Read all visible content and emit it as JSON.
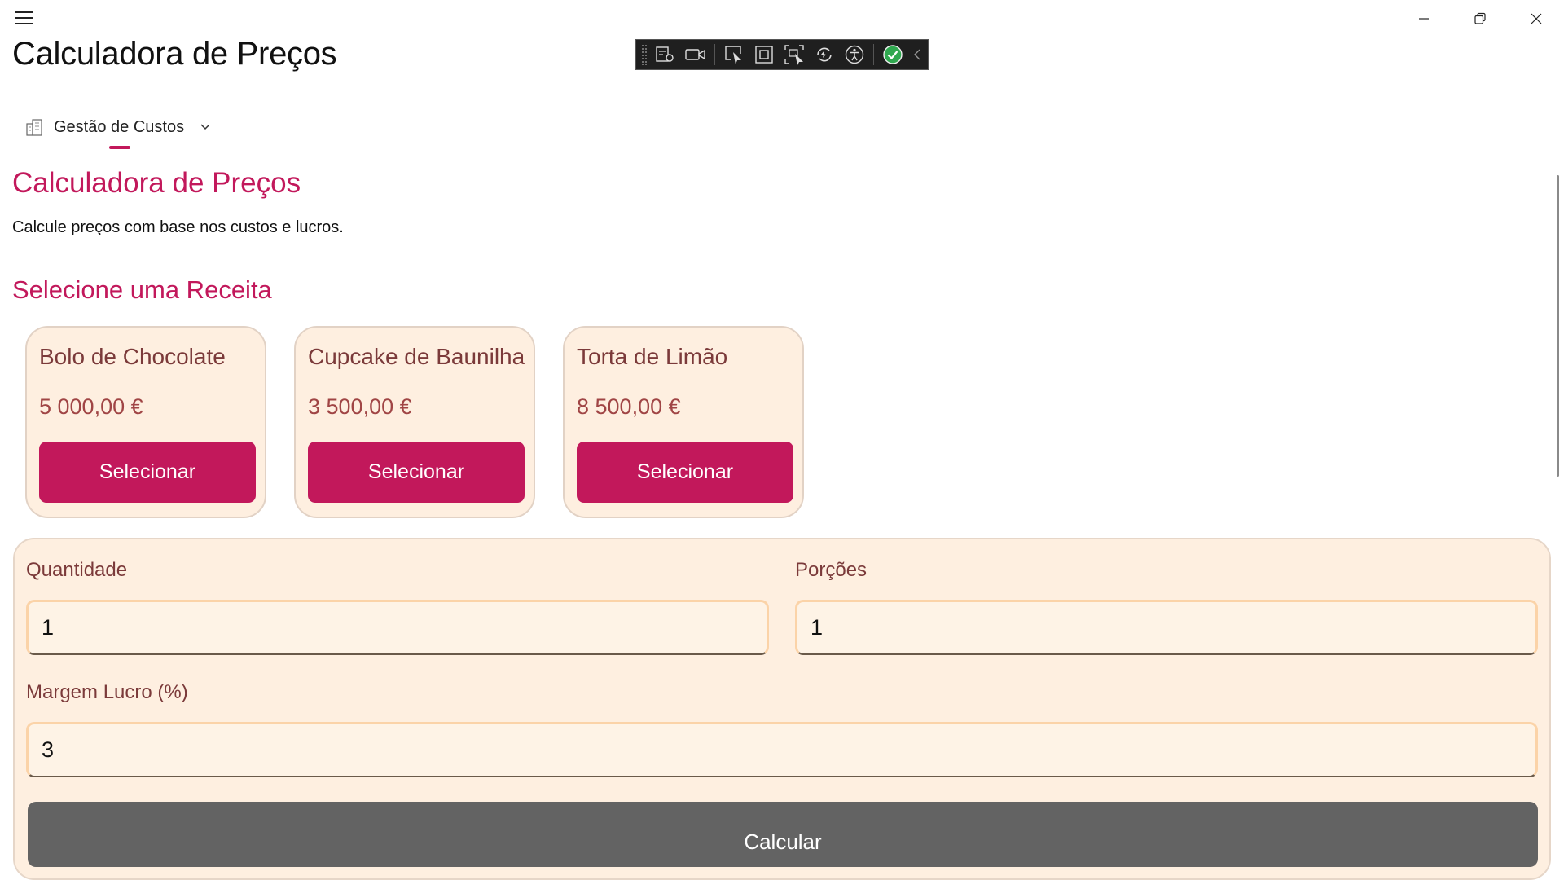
{
  "window": {
    "title": "Calculadora de Preços"
  },
  "nav": {
    "item_label": "Gestão de Custos"
  },
  "page": {
    "heading": "Calculadora de Preços",
    "subtitle": "Calcule preços com base nos custos e lucros.",
    "section_heading": "Selecione uma Receita"
  },
  "recipes": [
    {
      "name": "Bolo de Chocolate",
      "price": "5 000,00 €",
      "button": "Selecionar"
    },
    {
      "name": "Cupcake de Baunilha",
      "price": "3 500,00 €",
      "button": "Selecionar"
    },
    {
      "name": "Torta de Limão",
      "price": "8 500,00 €",
      "button": "Selecionar"
    }
  ],
  "form": {
    "quantity_label": "Quantidade",
    "quantity_value": "1",
    "portions_label": "Porções",
    "portions_value": "1",
    "margin_label": "Margem Lucro (%)",
    "margin_value": "3",
    "calculate_button": "Calcular"
  },
  "colors": {
    "accent": "#c2185b",
    "card_bg": "#feefe0",
    "label_text": "#7b3a3a",
    "price_text": "#a04545",
    "calc_button": "#636363"
  },
  "icons": {
    "menu": "hamburger-icon",
    "nav": "building-icon",
    "nav_expand": "chevron-down-icon",
    "minimize": "minimize-icon",
    "restore": "restore-icon",
    "close": "close-icon"
  }
}
